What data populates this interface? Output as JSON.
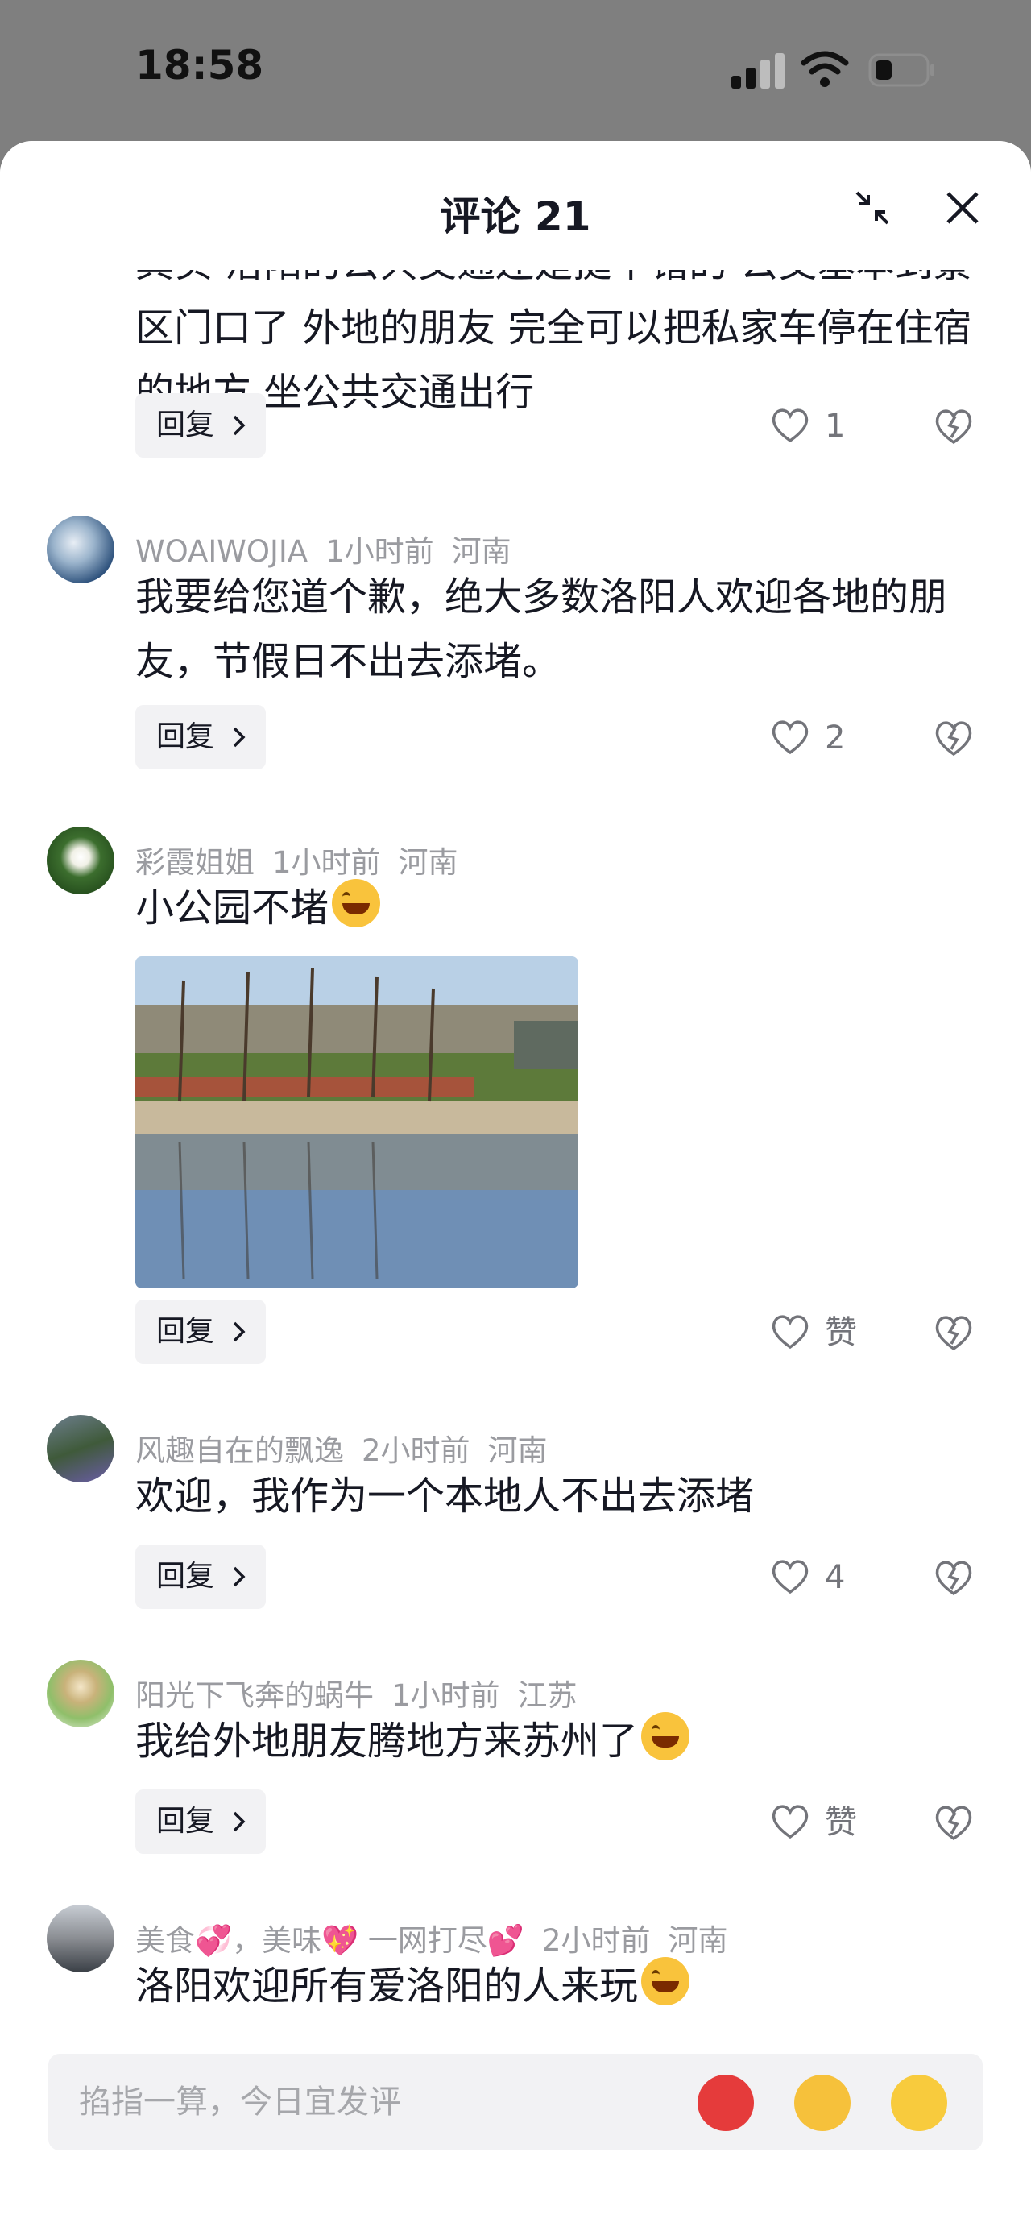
{
  "status": {
    "time": "18:58"
  },
  "header": {
    "title": "评论 21"
  },
  "comments": [
    {
      "text": "其实 洛阳的公共交通还是挺不错的 公交基本到景区门口了 外地的朋友 完全可以把私家车停在住宿的地方 坐公共交通出行",
      "likes": "1"
    },
    {
      "user": "WOAIWOJIA",
      "time": "1小时前",
      "location": "河南",
      "text": "我要给您道个歉，绝大多数洛阳人欢迎各地的朋友，节假日不出去添堵。",
      "likes": "2"
    },
    {
      "user": "彩霞姐姐",
      "time": "1小时前",
      "location": "河南",
      "text": "小公园不堵",
      "likes": "赞"
    },
    {
      "user": "风趣自在的飘逸",
      "time": "2小时前",
      "location": "河南",
      "text": "欢迎，我作为一个本地人不出去添堵",
      "likes": "4"
    },
    {
      "user": "阳光下飞奔的蜗牛",
      "time": "1小时前",
      "location": "江苏",
      "text": "我给外地朋友腾地方来苏州了",
      "likes": "赞"
    },
    {
      "user": "美食💞，美味💖 一网打尽💕",
      "time": "2小时前",
      "location": "河南",
      "text": "洛阳欢迎所有爱洛阳的人来玩"
    }
  ],
  "reply_label": "回复",
  "input": {
    "placeholder": "掐指一算，今日宜发评"
  },
  "colors": {
    "accent": "#161823",
    "meta": "#9a9ba0",
    "reply_bg": "#f2f2f4",
    "sheet_bg": "#ffffff",
    "backdrop": "#7f7f7f"
  }
}
